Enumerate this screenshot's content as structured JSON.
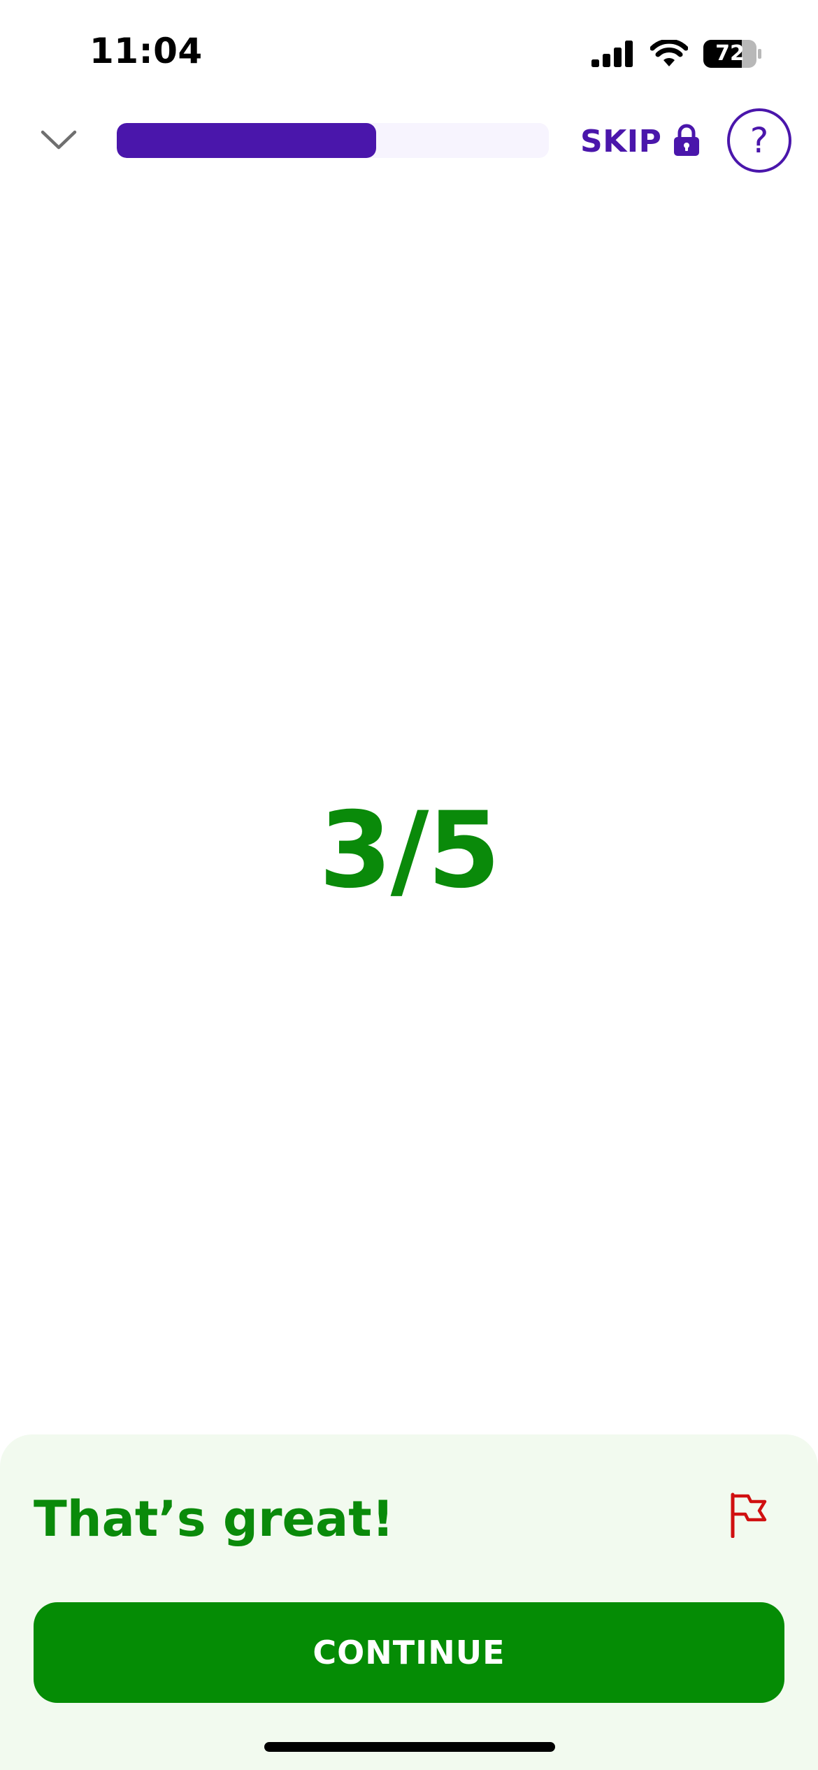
{
  "status_bar": {
    "time": "11:04",
    "battery_level": "72",
    "icons": [
      "signal-icon",
      "wifi-icon",
      "battery-icon"
    ]
  },
  "top_bar": {
    "collapse_icon": "chevron-down-icon",
    "progress_fraction": 0.6,
    "skip_label": "SKIP",
    "skip_icon": "lock-icon",
    "help_glyph": "?"
  },
  "main": {
    "score": "3/5"
  },
  "feedback": {
    "title": "That’s great!",
    "report_icon": "flag-icon",
    "continue_label": "CONTINUE"
  },
  "colors": {
    "accent_purple": "#4a16ab",
    "progress_track": "#f7f4fe",
    "success_green": "#0a8a0a",
    "button_green": "#058c05",
    "sheet_background": "#f2faef",
    "flag_red": "#d01010"
  }
}
